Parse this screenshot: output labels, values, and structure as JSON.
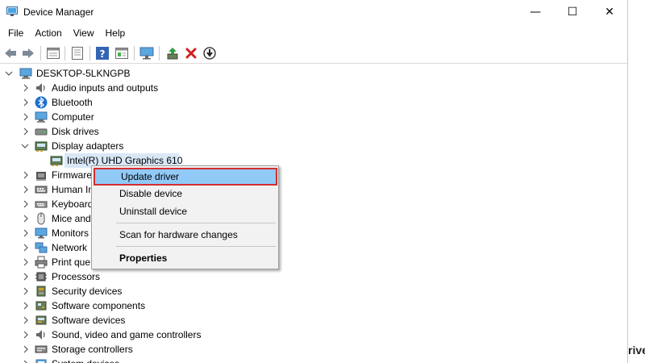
{
  "window": {
    "title": "Device Manager",
    "controls": {
      "minimize": "—",
      "maximize": "☐",
      "close": "✕"
    }
  },
  "menu": [
    "File",
    "Action",
    "View",
    "Help"
  ],
  "toolbar": [
    "back",
    "forward",
    "properties-sheet",
    "document",
    "help",
    "view-pane",
    "monitor",
    "update-driver",
    "uninstall",
    "install"
  ],
  "tree": {
    "root": "DESKTOP-5LKNGPB",
    "items": [
      {
        "label": "Audio inputs and outputs",
        "icon": "speaker-icon"
      },
      {
        "label": "Bluetooth",
        "icon": "bluetooth-icon"
      },
      {
        "label": "Computer",
        "icon": "computer-icon"
      },
      {
        "label": "Disk drives",
        "icon": "disk-icon"
      },
      {
        "label": "Display adapters",
        "icon": "display-adapter-icon",
        "expanded": true
      },
      {
        "label": "Intel(R) UHD Graphics 610",
        "icon": "display-adapter-icon",
        "child": true,
        "selected": true
      },
      {
        "label": "Firmware",
        "icon": "firmware-icon"
      },
      {
        "label": "Human In",
        "icon": "hid-icon"
      },
      {
        "label": "Keyboard",
        "icon": "keyboard-icon"
      },
      {
        "label": "Mice and",
        "icon": "mouse-icon"
      },
      {
        "label": "Monitors",
        "icon": "monitor-icon"
      },
      {
        "label": "Network",
        "icon": "network-icon"
      },
      {
        "label": "Print que",
        "icon": "printer-icon"
      },
      {
        "label": "Processors",
        "icon": "processor-icon"
      },
      {
        "label": "Security devices",
        "icon": "security-icon"
      },
      {
        "label": "Software components",
        "icon": "software-component-icon"
      },
      {
        "label": "Software devices",
        "icon": "software-device-icon"
      },
      {
        "label": "Sound, video and game controllers",
        "icon": "speaker-icon"
      },
      {
        "label": "Storage controllers",
        "icon": "storage-icon"
      },
      {
        "label": "System devices",
        "icon": "system-icon"
      }
    ]
  },
  "context_menu": {
    "items": [
      {
        "label": "Update driver",
        "highlighted": true
      },
      {
        "label": "Disable device"
      },
      {
        "label": "Uninstall device"
      },
      {
        "label": "Scan for hardware changes"
      },
      {
        "label": "Properties",
        "bold": true
      }
    ]
  },
  "background_text": "rive",
  "colors": {
    "highlight": "#91c9f7",
    "highlight_border": "#d32f2f",
    "selection": "#d9e8f7"
  }
}
